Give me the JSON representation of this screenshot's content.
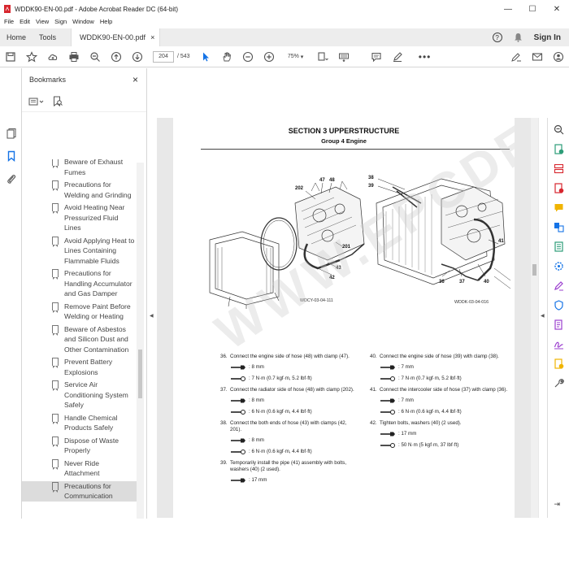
{
  "window": {
    "title": "WDDK90-EN-00.pdf - Adobe Acrobat Reader DC (64-bit)",
    "controls": [
      "—",
      "☐",
      "✕"
    ]
  },
  "menu": [
    "File",
    "Edit",
    "View",
    "Sign",
    "Window",
    "Help"
  ],
  "tabs": {
    "home": "Home",
    "tools": "Tools",
    "document": "WDDK90-EN-00.pdf",
    "close": "×",
    "signin": "Sign In",
    "help": "?"
  },
  "toolbar": {
    "page_current": "204",
    "page_total": "/ 543",
    "zoom": "75%"
  },
  "bookmarks": {
    "header": "Bookmarks",
    "close": "×",
    "items": [
      {
        "label": "Beware of Exhaust Fumes"
      },
      {
        "label": "Precautions for Welding and Grinding"
      },
      {
        "label": "Avoid Heating Near Pressurized Fluid Lines"
      },
      {
        "label": "Avoid Applying Heat to Lines Containing Flammable Fluids"
      },
      {
        "label": "Precautions for Handling Accumulator and Gas Damper"
      },
      {
        "label": "Remove Paint Before Welding or Heating"
      },
      {
        "label": "Beware of Asbestos and Silicon Dust and Other Contamination"
      },
      {
        "label": "Prevent Battery Explosions"
      },
      {
        "label": "Service Air Conditioning System Safely"
      },
      {
        "label": "Handle Chemical Products Safely"
      },
      {
        "label": "Dispose of Waste Properly"
      },
      {
        "label": "Never Ride Attachment"
      },
      {
        "label": "Precautions for Communication"
      }
    ]
  },
  "document": {
    "section": "SECTION 3 UPPERSTRUCTURE",
    "group": "Group 4 Engine",
    "watermark": "WWW.EPCDEPOT.COM",
    "figure_left_code": "WDCY-03-04-111",
    "figure_right_code": "WDDK-03-04-016",
    "left_labels": [
      "47",
      "48",
      "202",
      "201",
      "43",
      "42"
    ],
    "right_labels": [
      "38",
      "39",
      "41",
      "36",
      "37",
      "40"
    ],
    "left_steps": [
      {
        "n": "36.",
        "text": "Connect the engine side of hose (48) with clamp (47).",
        "torques": [
          ": 8 mm",
          ": 7 N·m (0.7 kgf·m, 5.2 lbf·ft)"
        ]
      },
      {
        "n": "37.",
        "text": "Connect the radiator side of hose (48) with clamp (202).",
        "torques": [
          ": 8 mm",
          ": 6 N·m (0.6 kgf·m, 4.4 lbf·ft)"
        ]
      },
      {
        "n": "38.",
        "text": "Connect the both ends of hose (43) with clamps (42, 201).",
        "torques": [
          ": 8 mm",
          ": 6 N·m (0.6 kgf·m, 4.4 lbf·ft)"
        ]
      },
      {
        "n": "39.",
        "text": "Temporarily install the pipe (41) assembly with bolts, washers (40) (2 used).",
        "torques": [
          ": 17 mm"
        ]
      }
    ],
    "right_steps": [
      {
        "n": "40.",
        "text": "Connect the engine side of hose (39) with clamp (38).",
        "torques": [
          ": 7 mm",
          ": 7 N·m (0.7 kgf·m, 5.2 lbf·ft)"
        ]
      },
      {
        "n": "41.",
        "text": "Connect the intercooler side of hose (37) with clamp (36).",
        "torques": [
          ": 7 mm",
          ": 6 N·m (0.6 kgf·m, 4.4 lbf·ft)"
        ]
      },
      {
        "n": "42.",
        "text": "Tighten bolts, washers (40) (2 used).",
        "torques": [
          ": 17 mm",
          ": 50 N·m (5 kgf·m, 37 lbf·ft)"
        ]
      }
    ]
  },
  "colors": {
    "accent": "#1473e6",
    "pdf_red": "#d7262e"
  }
}
